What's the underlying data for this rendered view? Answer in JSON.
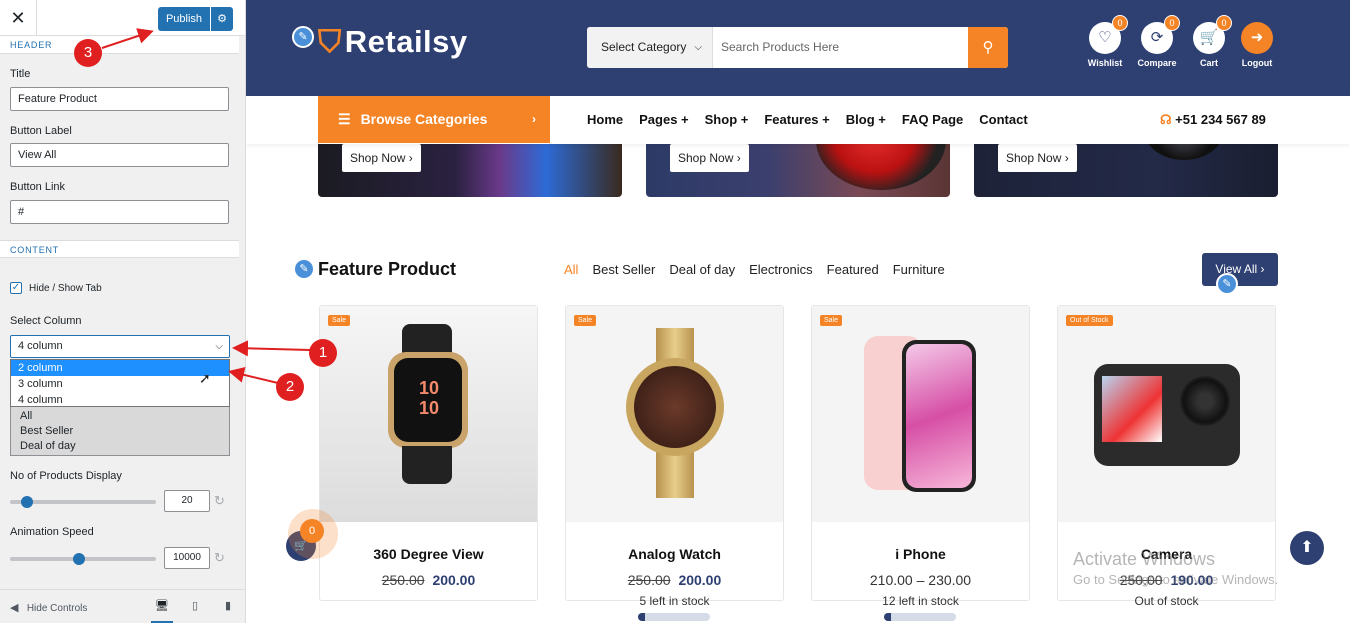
{
  "customizer": {
    "close_glyph": "✕",
    "publish_label": "Publish",
    "section_header": "HEADER",
    "title_label": "Title",
    "title_value": "Feature Product",
    "button_label_label": "Button Label",
    "button_label_value": "View All",
    "button_link_label": "Button Link",
    "button_link_value": "#",
    "section_content": "CONTENT",
    "hide_show_tab_label": "Hide / Show Tab",
    "hide_show_tab_checked": true,
    "select_column_label": "Select Column",
    "select_column_value": "4 column",
    "select_column_options": [
      "2 column",
      "3 column",
      "4 column"
    ],
    "highlighted_option": "2 column",
    "tabs_listbox": [
      "All",
      "Best Seller",
      "Deal of day"
    ],
    "products_display_label": "No of Products Display",
    "products_display_value": "20",
    "products_display_level": 0.08,
    "animation_speed_label": "Animation Speed",
    "animation_speed_value": "10000",
    "animation_speed_level": 0.47,
    "hide_controls_label": "Hide Controls"
  },
  "annotations": [
    "1",
    "2",
    "3"
  ],
  "site": {
    "brand": "Retailsy",
    "search": {
      "category": "Select Category",
      "placeholder": "Search Products Here"
    },
    "header_icons": [
      {
        "label": "Wishlist",
        "badge": "0",
        "icon": "heart-icon"
      },
      {
        "label": "Compare",
        "badge": "0",
        "icon": "refresh-icon"
      },
      {
        "label": "Cart",
        "badge": "0",
        "icon": "cart-icon"
      },
      {
        "label": "Logout",
        "icon": "logout-icon"
      }
    ],
    "browse_label": "Browse Categories",
    "menu": [
      "Home",
      "Pages +",
      "Shop +",
      "Features +",
      "Blog +",
      "FAQ Page",
      "Contact"
    ],
    "phone": "+51 234 567 89",
    "banner_button": "Shop Now ›",
    "section_title": "Feature Product",
    "tabs": [
      "All",
      "Best Seller",
      "Deal of day",
      "Electronics",
      "Featured",
      "Furniture"
    ],
    "view_all": "View All ›",
    "products": [
      {
        "name": "360 Degree View",
        "old": "250.00",
        "price": "200.00",
        "tag": "Sale",
        "stock": ""
      },
      {
        "name": "Analog Watch",
        "old": "250.00",
        "price": "200.00",
        "tag": "Sale",
        "stock": "5 left in stock",
        "stock_level": 0.1
      },
      {
        "name": "i Phone",
        "range": "210.00 – 230.00",
        "tag": "Sale",
        "stock": "12 left in stock",
        "stock_level": 0.1
      },
      {
        "name": "Camera",
        "old": "250.00",
        "price": "190.00",
        "tag": "Out of Stock",
        "stock": "Out of stock"
      }
    ],
    "floating_cart_count": "0",
    "watermark_title": "Activate Windows",
    "watermark_sub": "Go to Settings to activate Windows."
  },
  "colors": {
    "navy": "#2e4072",
    "orange": "#f58426",
    "wp_blue": "#2271b1",
    "annotation_red": "#e02020"
  }
}
